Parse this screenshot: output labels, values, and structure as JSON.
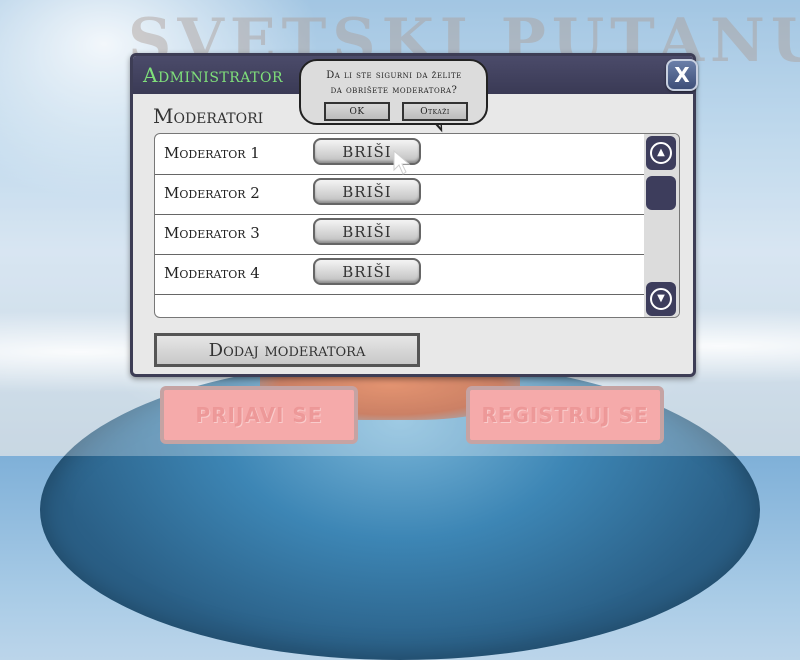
{
  "background": {
    "title": "SVETSKI PUTANU",
    "login_button": "PRIJAVI SE",
    "register_button": "REGISTRUJ SE"
  },
  "dialog": {
    "title": "Administrator",
    "close_label": "X",
    "section_title": "Moderatori",
    "moderators": [
      {
        "name": "Moderator 1",
        "delete_label": "BRIŠI"
      },
      {
        "name": "Moderator 2",
        "delete_label": "BRIŠI"
      },
      {
        "name": "Moderator 3",
        "delete_label": "BRIŠI"
      },
      {
        "name": "Moderator 4",
        "delete_label": "BRIŠI"
      }
    ],
    "add_button": "Dodaj moderatora"
  },
  "confirm": {
    "line1": "Da li ste sigurni da želite",
    "line2": "da obrišete moderatora?",
    "ok_label": "OK",
    "cancel_label": "Otkaži"
  },
  "colors": {
    "title_green": "#7fe07a",
    "header_dark": "#3a3a55",
    "scroll_dark": "#3d3d5c",
    "bg_button_red": "#f28a8a"
  }
}
